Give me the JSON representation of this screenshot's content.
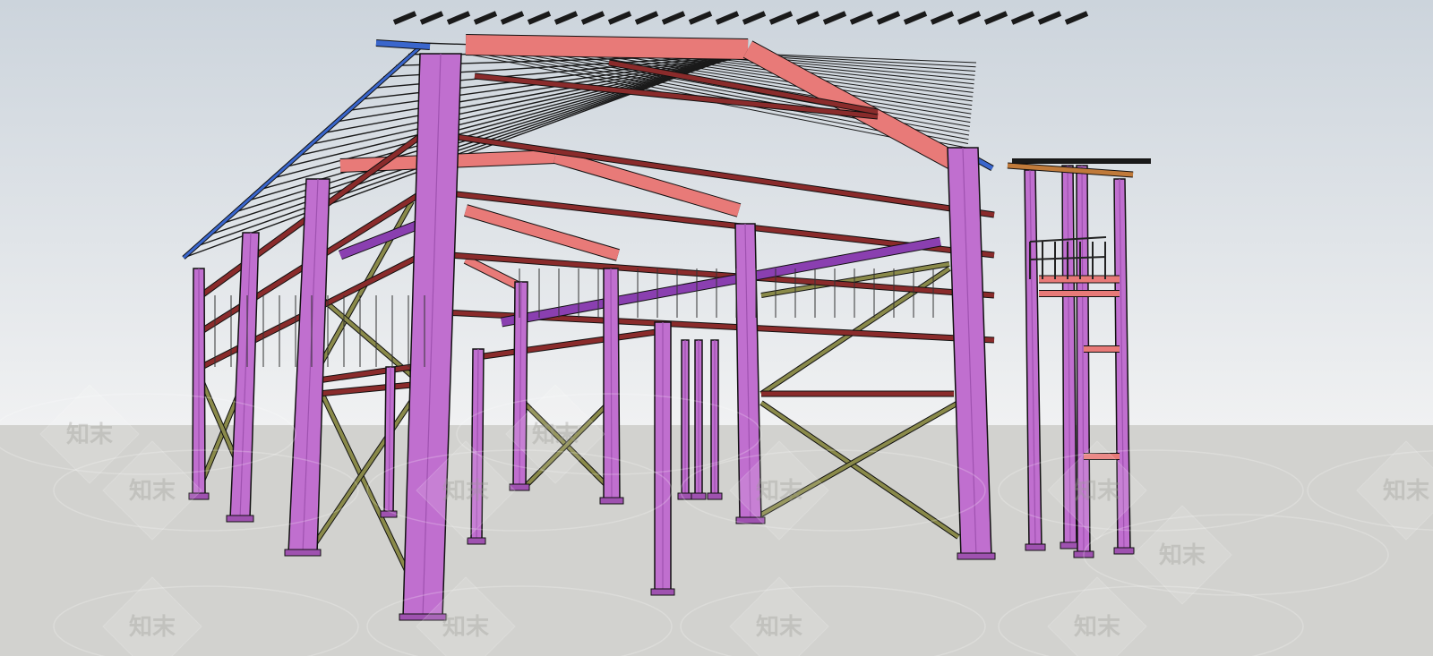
{
  "scene": {
    "subject": "steel-frame-building-3d-model",
    "colors": {
      "sky_top": "#ccd4dc",
      "sky_bottom": "#f0f1f2",
      "ground": "#d2d2cf",
      "column": "#c06fcf",
      "column_dark": "#9f52b0",
      "rafter": "#e87a78",
      "rafter_dark": "#c85a5a",
      "purlin": "#8a2b2b",
      "brace": "#8a8a4a",
      "edge_beam": "#3a66cc",
      "roof_line": "#1a1a1a"
    }
  },
  "watermark": {
    "brand": "知末",
    "tiles": [
      {
        "text": "知末"
      },
      {
        "text": "知末"
      },
      {
        "text": "知末"
      },
      {
        "text": "知末"
      },
      {
        "text": "知末"
      },
      {
        "text": "知末"
      },
      {
        "text": "知末"
      },
      {
        "text": "知末"
      },
      {
        "text": "知末"
      },
      {
        "text": "知末"
      },
      {
        "text": "知末"
      },
      {
        "text": "知末"
      }
    ]
  }
}
